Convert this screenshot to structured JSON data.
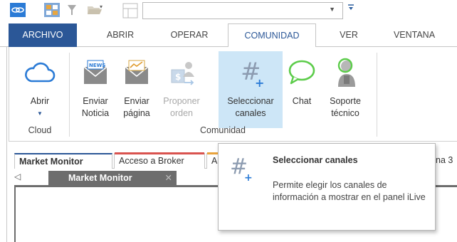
{
  "colors": {
    "accent": "#2b5797",
    "selected_bg": "#cde6f7",
    "disabled": "#a8a8a8",
    "tab_gray": "#6d6d6d"
  },
  "quick_access": {
    "icons": [
      "chain-link-icon",
      "grid-icon",
      "filter-icon",
      "folder-open-icon",
      "layout-icon"
    ],
    "combo_value": ""
  },
  "tabs": [
    {
      "label": "ARCHIVO",
      "kind": "file"
    },
    {
      "label": "ABRIR"
    },
    {
      "label": "OPERAR"
    },
    {
      "label": "COMUNIDAD",
      "kind": "active"
    },
    {
      "label": "VER"
    },
    {
      "label": "VENTANA"
    }
  ],
  "ribbon": {
    "cloud_group": {
      "label": "Cloud",
      "buttons": [
        {
          "label": "Abrir",
          "icon": "cloud-icon",
          "has_dropdown": true
        }
      ]
    },
    "community_group": {
      "label": "Comunidad",
      "buttons": [
        {
          "line1": "Enviar",
          "line2": "Noticia",
          "icon": "news-envelope-icon"
        },
        {
          "line1": "Enviar",
          "line2": "página",
          "icon": "chart-envelope-icon"
        },
        {
          "line1": "Proponer",
          "line2": "orden",
          "icon": "propose-order-icon",
          "disabled": true
        },
        {
          "line1": "Seleccionar",
          "line2": "canales",
          "icon": "hashtag-icon",
          "selected": true
        },
        {
          "line1": "Chat",
          "line2": "",
          "icon": "chat-bubble-icon"
        },
        {
          "line1": "Soporte",
          "line2": "técnico",
          "icon": "support-person-icon"
        }
      ]
    }
  },
  "doc_tabs": [
    {
      "label": "Market Monitor",
      "active": true
    },
    {
      "label": "Acceso a Broker"
    },
    {
      "label": "A"
    },
    {
      "label": "na 3"
    }
  ],
  "sub_tab": {
    "label": "Market Monitor",
    "close": "✕",
    "left_arrow": "◁"
  },
  "tooltip": {
    "title": "Seleccionar canales",
    "description": "Permite elegir los canales de información a mostrar en el panel iLive"
  }
}
